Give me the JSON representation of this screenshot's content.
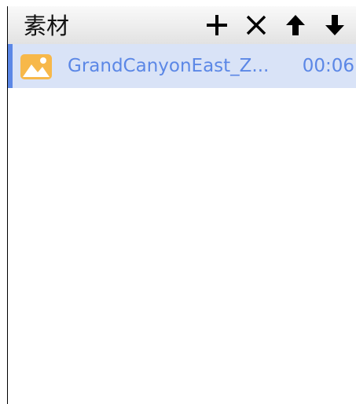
{
  "panel": {
    "title": "素材",
    "toolbar": [
      {
        "name": "add",
        "icon": "plus-icon"
      },
      {
        "name": "remove",
        "icon": "close-icon"
      },
      {
        "name": "move-up",
        "icon": "arrow-up-icon"
      },
      {
        "name": "move-down",
        "icon": "arrow-down-icon"
      }
    ]
  },
  "materials": [
    {
      "name": "GrandCanyonEast_Z...",
      "duration": "00:06",
      "type_icon": "image-icon",
      "selected": true
    }
  ],
  "colors": {
    "accent": "#5b87e6",
    "selected_row_bg": "#d9e3f7",
    "image_icon": "#f7b84a"
  }
}
